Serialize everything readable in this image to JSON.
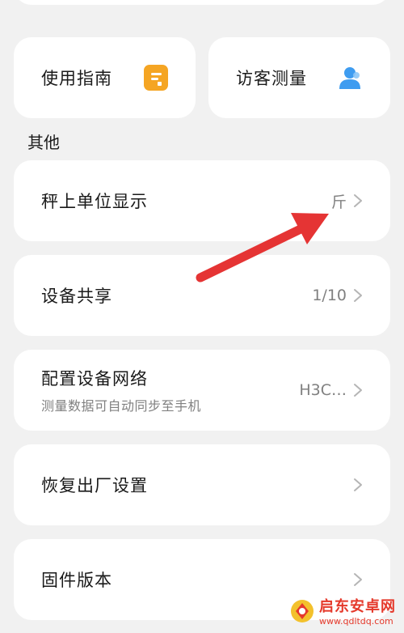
{
  "quick_actions": [
    {
      "label": "使用指南",
      "icon": "guide-document-icon",
      "color": "#f5a523"
    },
    {
      "label": "访客测量",
      "icon": "visitor-person-icon",
      "color": "#3e9cf0"
    }
  ],
  "section_title": "其他",
  "settings": {
    "unit": {
      "label": "秤上单位显示",
      "value": "斤"
    },
    "share": {
      "label": "设备共享",
      "value": "1/10"
    },
    "network": {
      "label": "配置设备网络",
      "sub": "测量数据可自动同步至手机",
      "value": "H3C…"
    },
    "reset": {
      "label": "恢复出厂设置"
    },
    "firmware": {
      "label": "固件版本"
    }
  },
  "watermark": {
    "name": "启东安卓网",
    "url": "www.qdltdq.com"
  },
  "colors": {
    "arrow": "#e53434",
    "background": "#f1f1f1",
    "card": "#ffffff"
  }
}
